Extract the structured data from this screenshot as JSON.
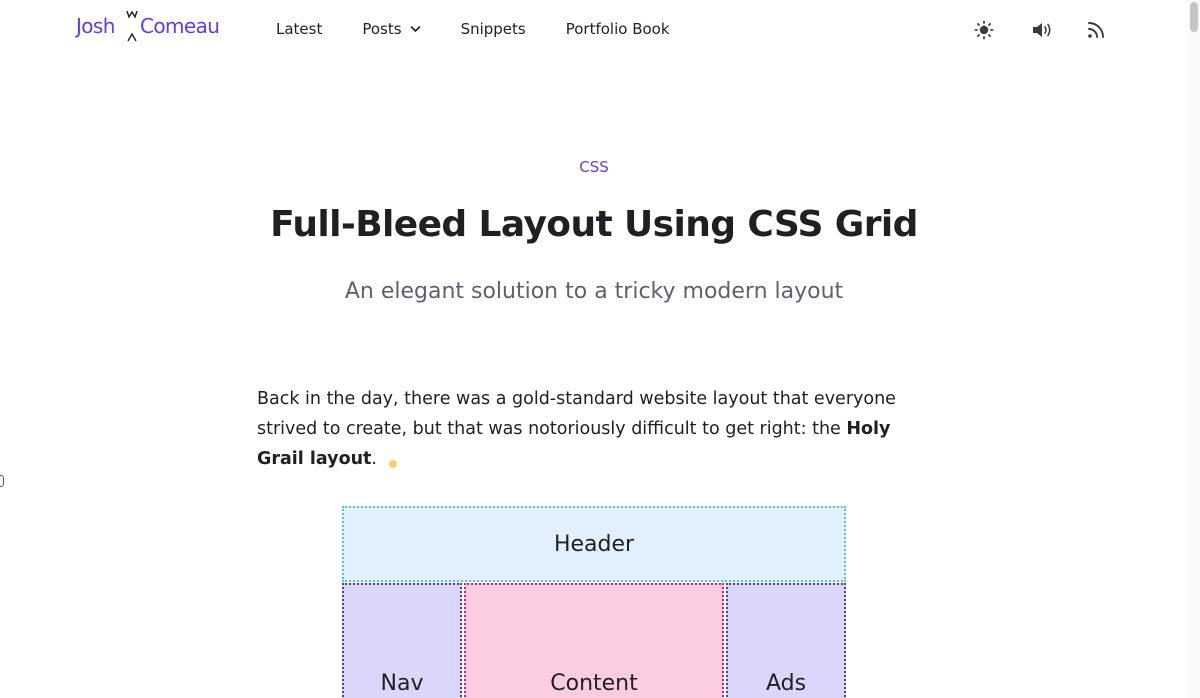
{
  "colors": {
    "accent": "#5b3df5",
    "text": "#1f1f24",
    "muted": "#5d6170",
    "header_bg": "#e1f0fc",
    "side_bg": "#dbd6fb",
    "content_bg": "#fbcce2"
  },
  "site": {
    "logo_first": "Josh",
    "logo_last": "Comeau"
  },
  "nav": {
    "latest": "Latest",
    "posts": "Posts",
    "snippets": "Snippets",
    "portfolio": "Portfolio Book"
  },
  "icons": {
    "theme": "sun-icon",
    "sound": "speaker-icon",
    "rss": "rss-icon",
    "dropdown": "chevron-down-icon"
  },
  "article": {
    "category": "CSS",
    "title": "Full-Bleed Layout Using CSS Grid",
    "subtitle": "An elegant solution to a tricky modern layout",
    "intro_text": "Back in the day, there was a gold-standard website layout that everyone strived to create, but that was notoriously difficult to get right: the ",
    "intro_bold": "Holy Grail layout",
    "intro_end": "."
  },
  "diagram": {
    "header": "Header",
    "nav": "Nav",
    "content": "Content",
    "ads": "Ads"
  }
}
